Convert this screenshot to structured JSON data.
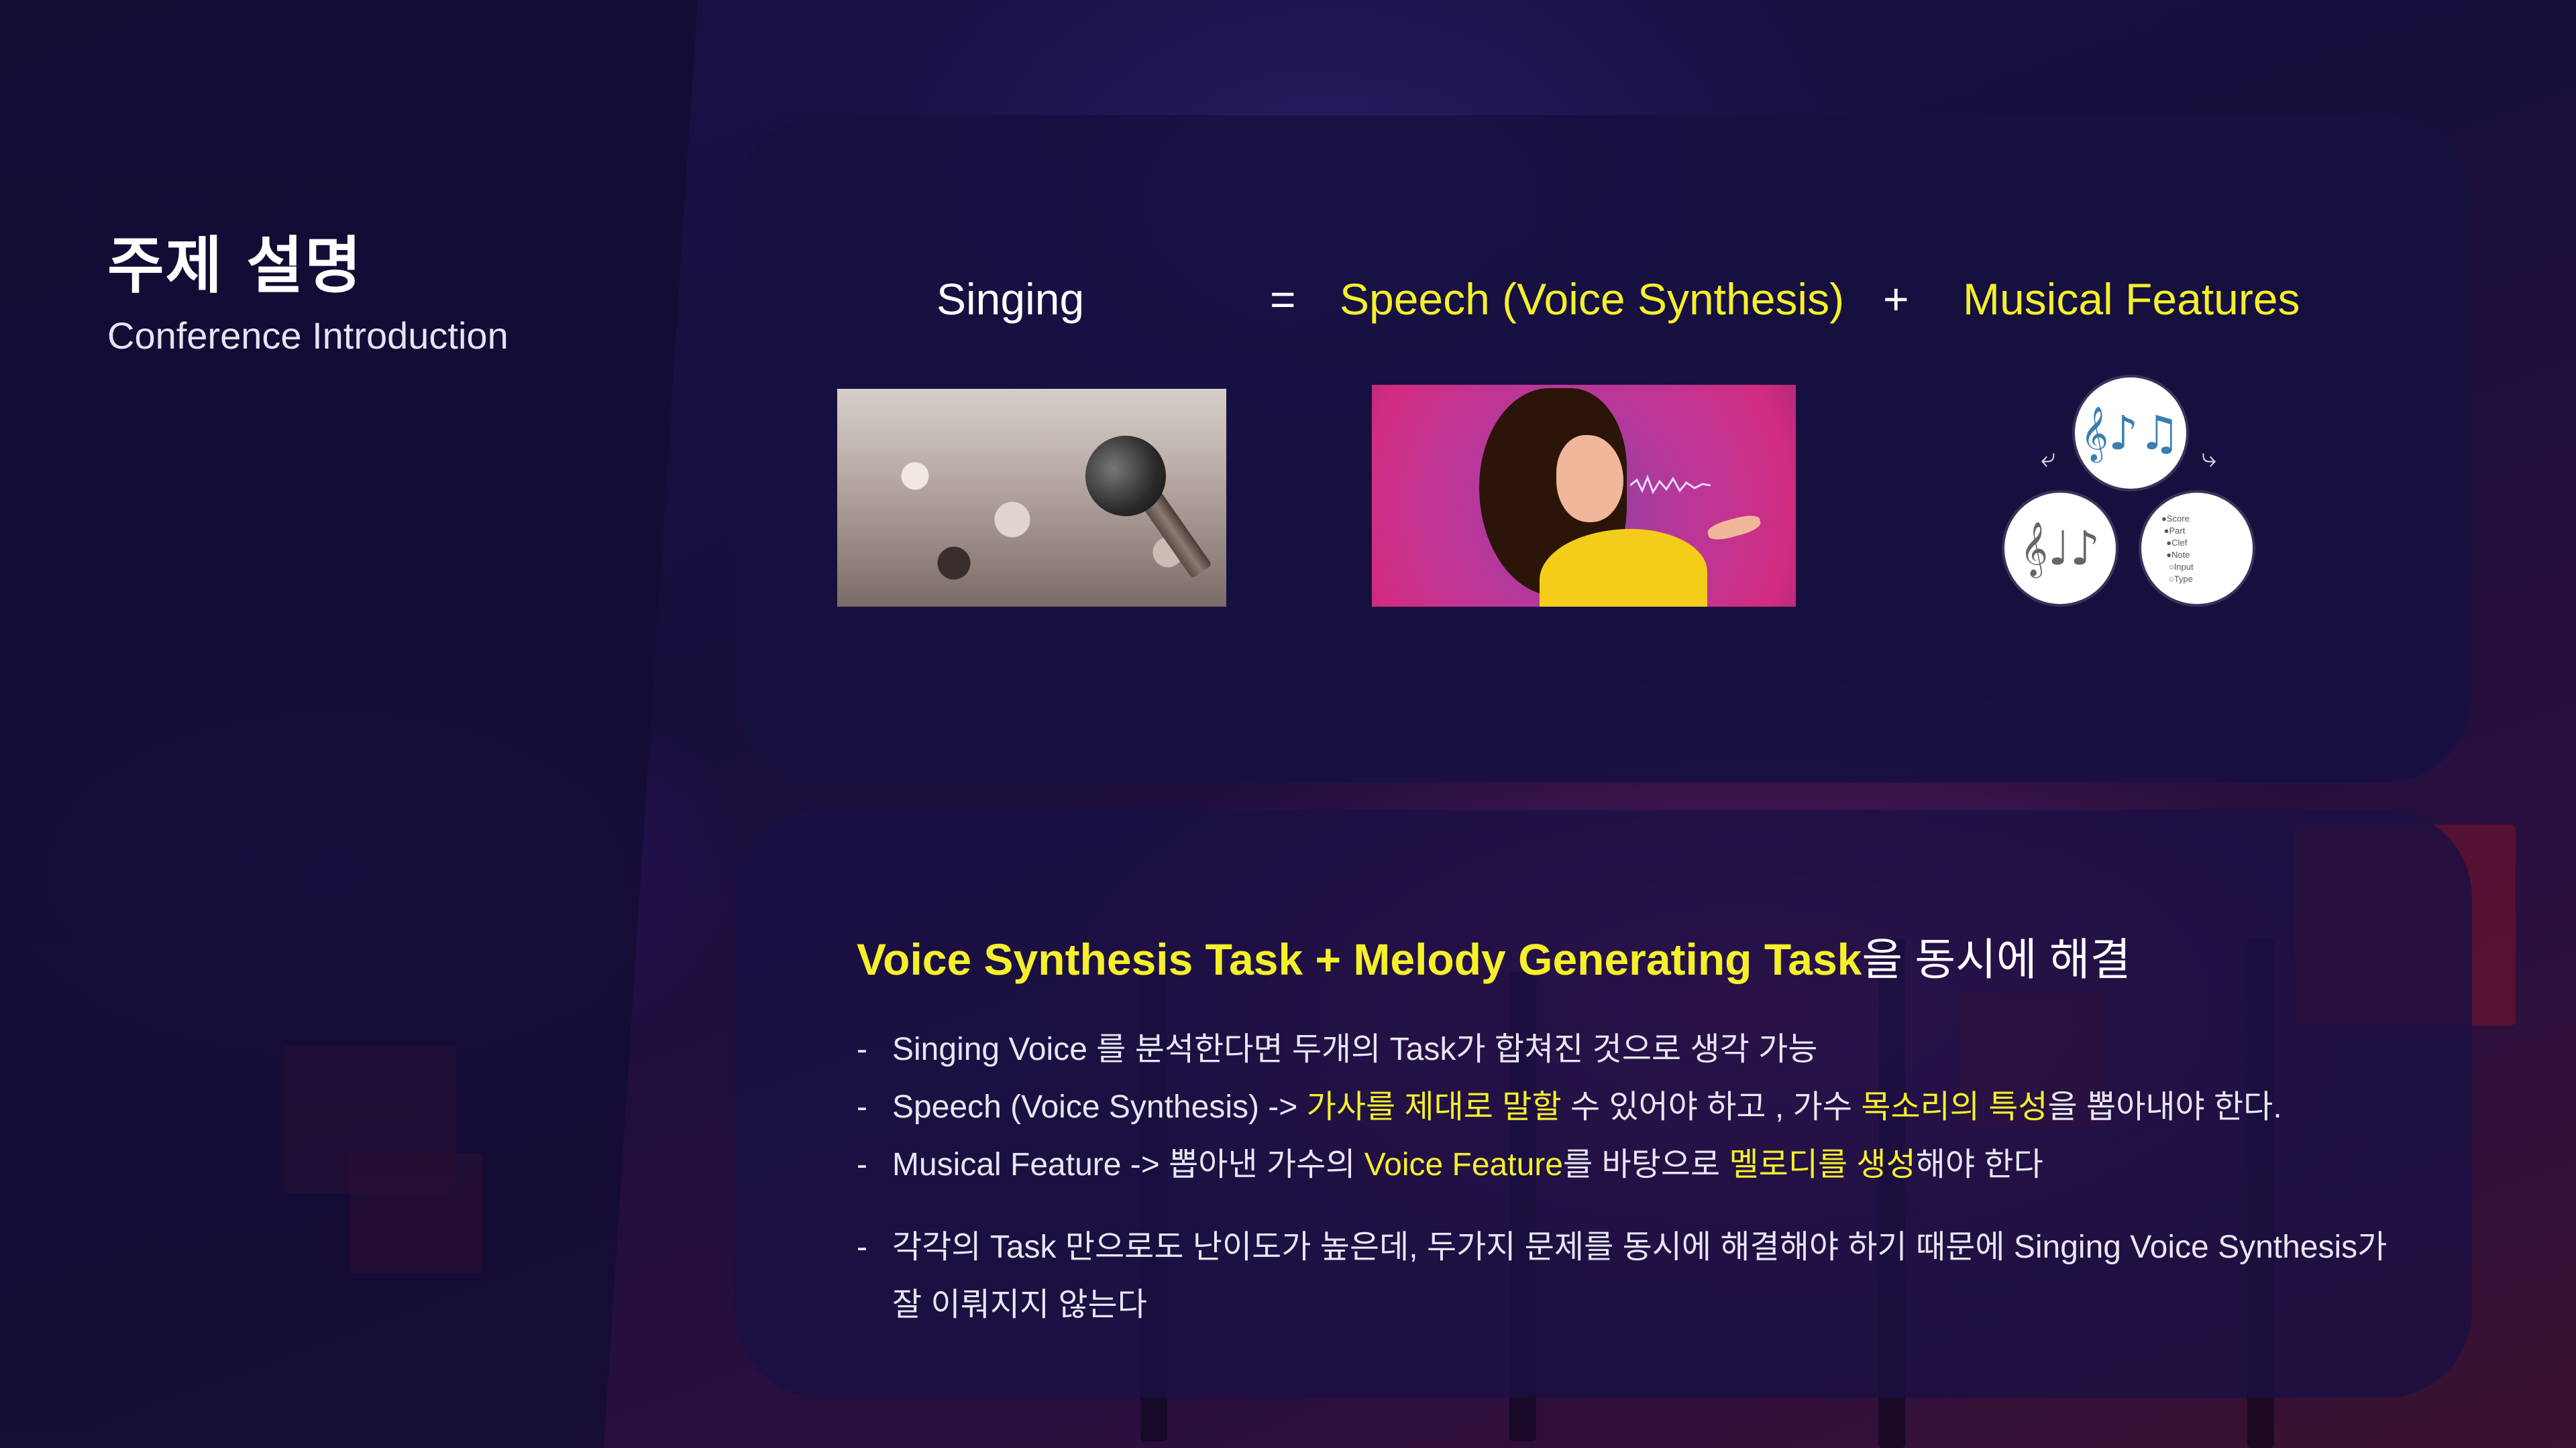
{
  "header": {
    "title": "주제 설명",
    "subtitle": "Conference Introduction"
  },
  "equation": {
    "singing": "Singing",
    "equals": "=",
    "speech": "Speech (Voice Synthesis)",
    "plus": "+",
    "musical": "Musical Features"
  },
  "images": {
    "singing_image": "microphone-crowd",
    "speech_image": "woman-singing",
    "musical_image": "music-score-circles"
  },
  "summary": {
    "heading_highlight": "Voice Synthesis Task + Melody Generating Task",
    "heading_rest": "을 동시에 해결",
    "bullets": [
      {
        "dash": "-",
        "parts": [
          {
            "text": "Singing Voice 를 분석한다면 두개의 Task가 합쳐진 것으로 생각 가능",
            "highlight": false
          }
        ]
      },
      {
        "dash": "-",
        "parts": [
          {
            "text": "Speech (Voice Synthesis) -> ",
            "highlight": false
          },
          {
            "text": "가사를 제대로 말할",
            "highlight": true
          },
          {
            "text": " 수 있어야 하고 , 가수 ",
            "highlight": false
          },
          {
            "text": "목소리의 특성",
            "highlight": true
          },
          {
            "text": "을 뽑아내야 한다.",
            "highlight": false
          }
        ]
      },
      {
        "dash": "-",
        "parts": [
          {
            "text": "Musical Feature -> 뽑아낸 가수의 ",
            "highlight": false
          },
          {
            "text": "Voice Feature",
            "highlight": true
          },
          {
            "text": "를 바탕으로 ",
            "highlight": false
          },
          {
            "text": "멜로디를 생성",
            "highlight": true
          },
          {
            "text": "해야 한다",
            "highlight": false
          }
        ]
      },
      {
        "dash": "-",
        "parts": [
          {
            "text": "각각의 Task 만으로도 난이도가 높은데, 두가지 문제를 동시에 해결해야 하기 때문에 Singing Voice Synthesis가",
            "highlight": false
          }
        ]
      },
      {
        "dash": "",
        "parts": [
          {
            "text": "잘 이뤄지지 않는다",
            "highlight": false
          }
        ]
      }
    ]
  },
  "colors": {
    "accent": "#f5f02a",
    "text": "#ffffff",
    "card": "#161040"
  }
}
